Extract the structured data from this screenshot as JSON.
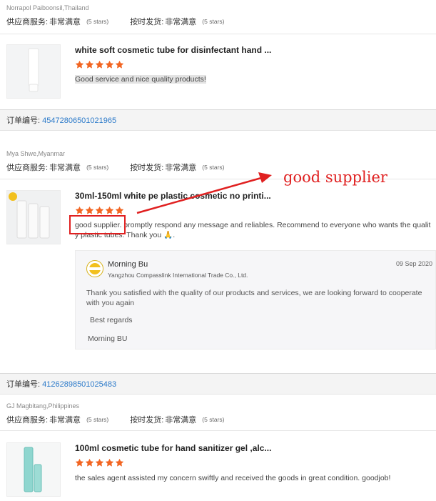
{
  "labels": {
    "supplier_service": "供应商服务:",
    "shipping": "按时发货:",
    "order_no": "订单编号:"
  },
  "reviews": [
    {
      "reviewer": "Norrapol Paiboonsil,Thailand",
      "supplier_rating": "非常满意",
      "supplier_stars": "(5 stars)",
      "shipping_rating": "非常满意",
      "shipping_stars": "(5 stars)",
      "product_title": "white soft cosmetic tube for disinfectant hand ...",
      "rating": 5,
      "comment": "Good service and nice quality products!"
    },
    {
      "order_number": "45472806501021965",
      "reviewer": "Mya Shwe,Myanmar",
      "supplier_rating": "非常满意",
      "supplier_stars": "(5 stars)",
      "shipping_rating": "非常满意",
      "shipping_stars": "(5 stars)",
      "product_title": "30ml-150ml white pe plastic cosmetic no printi...",
      "rating": 5,
      "comment_highlight": "good supplier.",
      "comment_rest": " promptly respond any message and reliables. Recommend to everyone who wants the qualit",
      "comment_line2": "y plastic tubes. Thank you 🙏.",
      "reply": {
        "name": "Morning Bu",
        "company": "Yangzhou Compasslink International Trade Co., Ltd.",
        "logo_text": "COMPASSLINK",
        "date": "09 Sep 2020",
        "text": "Thank you satisfied with the quality of our products and services, we are looking forward to cooperate with you again",
        "regards": "Best regards",
        "signoff": "Morning BU"
      }
    },
    {
      "order_number": "41262898501025483",
      "reviewer": "GJ Magbitang,Philippines",
      "supplier_rating": "非常满意",
      "supplier_stars": "(5 stars)",
      "shipping_rating": "非常满意",
      "shipping_stars": "(5 stars)",
      "product_title": "100ml cosmetic tube for hand sanitizer gel ,alc...",
      "rating": 5,
      "comment": "the sales agent assisted my concern swiftly and received the goods in great condition. goodjob!"
    }
  ],
  "annotation": {
    "text": "good supplier",
    "color": "#e02020"
  },
  "colors": {
    "star": "#f26522",
    "order_link": "#2a79c9",
    "annotation": "#e02020"
  }
}
